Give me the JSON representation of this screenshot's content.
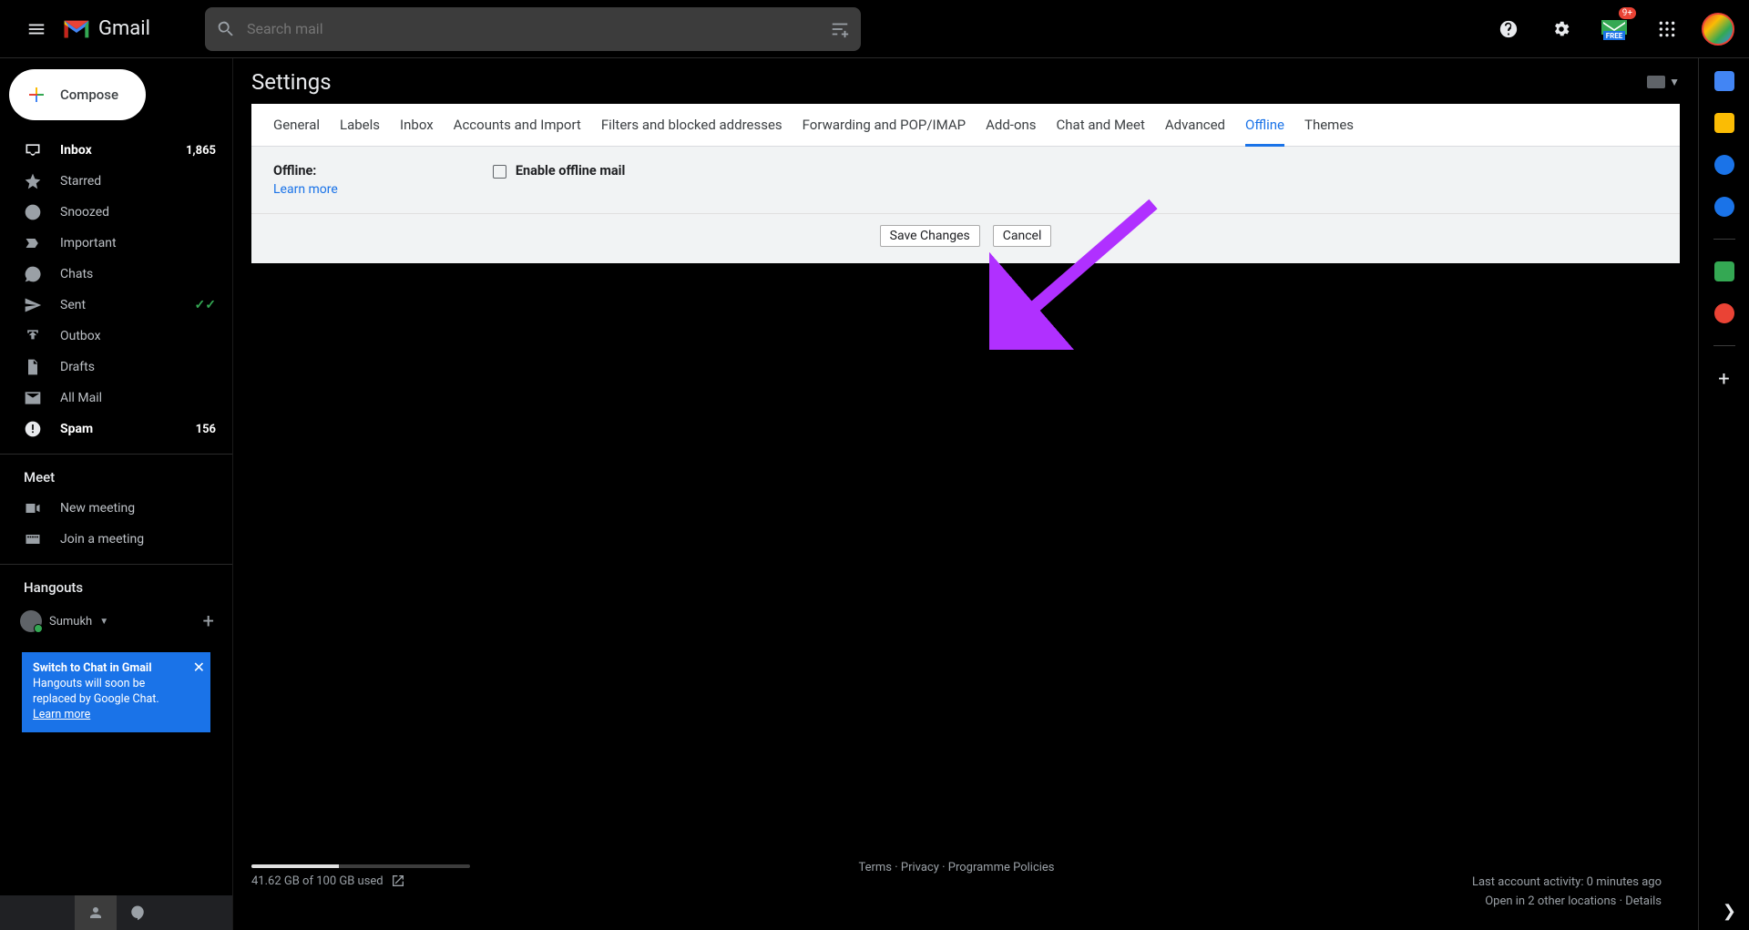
{
  "header": {
    "logo_text": "Gmail",
    "search_placeholder": "Search mail",
    "notification_badge": "9+"
  },
  "sidebar": {
    "compose": "Compose",
    "nav": [
      {
        "icon": "inbox",
        "label": "Inbox",
        "count": "1,865",
        "bold": true
      },
      {
        "icon": "star",
        "label": "Starred"
      },
      {
        "icon": "clock",
        "label": "Snoozed"
      },
      {
        "icon": "important",
        "label": "Important"
      },
      {
        "icon": "chat",
        "label": "Chats"
      },
      {
        "icon": "send",
        "label": "Sent",
        "checks": true
      },
      {
        "icon": "outbox",
        "label": "Outbox"
      },
      {
        "icon": "draft",
        "label": "Drafts"
      },
      {
        "icon": "mail",
        "label": "All Mail"
      },
      {
        "icon": "spam",
        "label": "Spam",
        "count": "156",
        "bold": true
      }
    ],
    "meet_title": "Meet",
    "meet_items": [
      {
        "icon": "video",
        "label": "New meeting"
      },
      {
        "icon": "keyboard",
        "label": "Join a meeting"
      }
    ],
    "hangouts_title": "Hangouts",
    "hangouts_user": "Sumukh",
    "promo_title": "Switch to Chat in Gmail",
    "promo_body": "Hangouts will soon be replaced by Google Chat.",
    "promo_learn": "Learn more"
  },
  "settings": {
    "title": "Settings",
    "tabs": [
      "General",
      "Labels",
      "Inbox",
      "Accounts and Import",
      "Filters and blocked addresses",
      "Forwarding and POP/IMAP",
      "Add-ons",
      "Chat and Meet",
      "Advanced",
      "Offline",
      "Themes"
    ],
    "active_tab": "Offline",
    "offline_label": "Offline:",
    "learn_more": "Learn more",
    "enable_label": "Enable offline mail",
    "save_btn": "Save Changes",
    "cancel_btn": "Cancel"
  },
  "footer": {
    "storage": "41.62 GB of 100 GB used",
    "terms": "Terms",
    "privacy": "Privacy",
    "policies": "Programme Policies",
    "activity": "Last account activity: 0 minutes ago",
    "open_in": "Open in 2 other locations",
    "details": "Details"
  }
}
